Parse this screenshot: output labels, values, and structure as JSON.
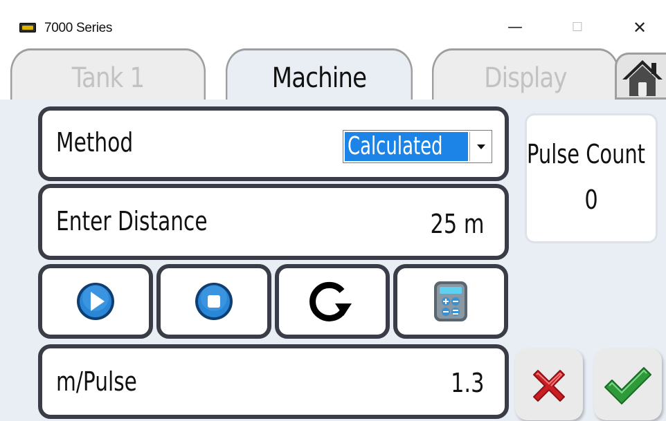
{
  "window": {
    "title": "7000 Series",
    "minimize_glyph": "—",
    "maximize_glyph": "☐",
    "close_glyph": "✕"
  },
  "tabs": [
    {
      "label": "Tank 1",
      "state": "inactive"
    },
    {
      "label": "Machine",
      "state": "active"
    },
    {
      "label": "Display",
      "state": "inactive"
    }
  ],
  "home_icon": "home-icon",
  "method": {
    "label": "Method",
    "selected": "Calculated"
  },
  "distance": {
    "label": "Enter Distance",
    "value": "25 m"
  },
  "controls": {
    "icons": [
      "play-icon",
      "stop-icon",
      "reset-icon",
      "calculator-icon"
    ]
  },
  "pulse": {
    "label": "Pulse Count",
    "value": "0"
  },
  "m_per_pulse": {
    "label": "m/Pulse",
    "value": "1.3"
  },
  "actions": {
    "cancel_icon": "cancel-x-icon",
    "ok_icon": "ok-check-icon"
  },
  "colors": {
    "panel_bg": "#e9eef5",
    "field_border": "#3a3d47",
    "selection_blue": "#1c84e6",
    "play_blue": "#1e73c8",
    "cancel_red": "#d7262b",
    "ok_green": "#2e9a3a"
  }
}
